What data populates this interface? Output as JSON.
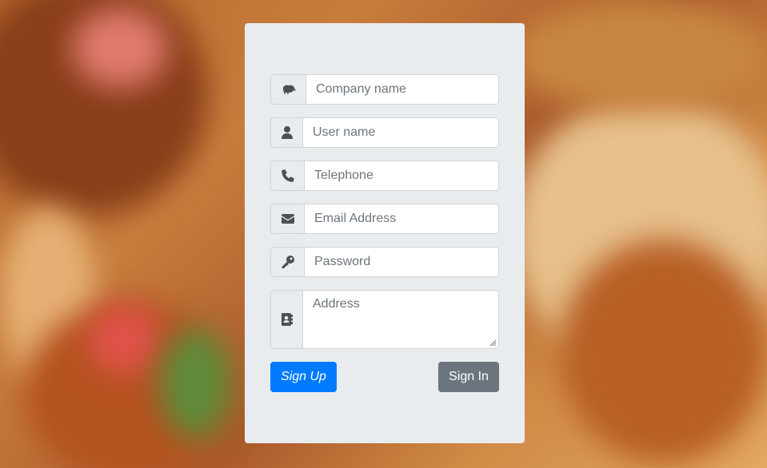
{
  "background": {
    "description_icon": "chicken-photo-background"
  },
  "form": {
    "company": {
      "placeholder": "Company name",
      "icon": "kiwi-bird-icon"
    },
    "username": {
      "placeholder": "User name",
      "icon": "user-icon"
    },
    "telephone": {
      "placeholder": "Telephone",
      "icon": "phone-icon"
    },
    "email": {
      "placeholder": "Email Address",
      "icon": "envelope-icon"
    },
    "password": {
      "placeholder": "Password",
      "icon": "key-icon"
    },
    "address": {
      "placeholder": "Address",
      "icon": "address-book-icon"
    },
    "signup_label": "Sign Up",
    "signin_label": "Sign In"
  },
  "colors": {
    "primary": "#007bff",
    "secondary": "#6c757d",
    "card": "#e9ecef"
  }
}
